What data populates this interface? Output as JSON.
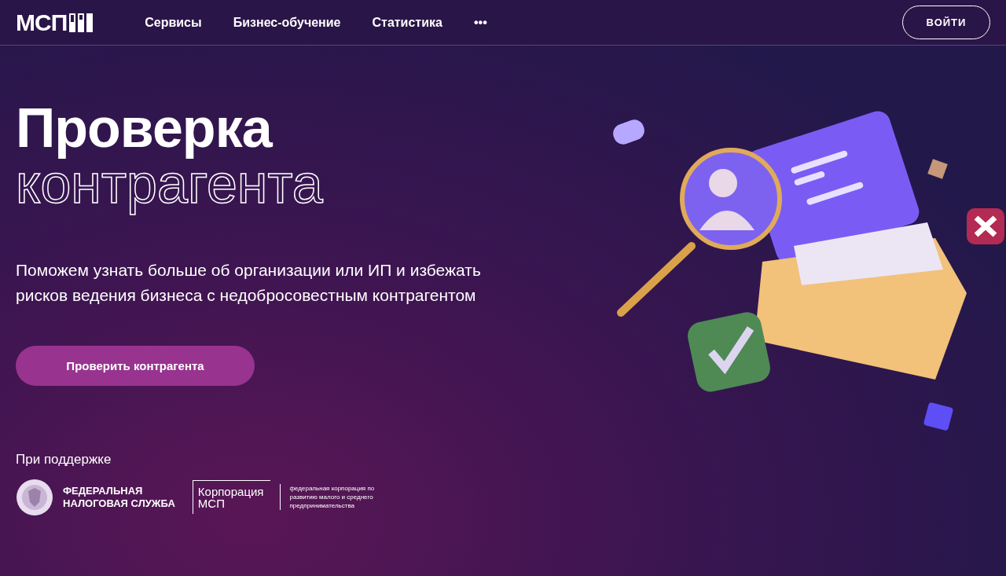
{
  "header": {
    "logo": "МСП",
    "nav": [
      {
        "label": "Сервисы"
      },
      {
        "label": "Бизнес-обучение"
      },
      {
        "label": "Статистика"
      },
      {
        "label": "•••"
      }
    ],
    "login": "ВОЙТИ"
  },
  "hero": {
    "title": "Проверка",
    "title_outline": "контрагента",
    "description": "Поможем узнать больше об организации или ИП и избежать рисков ведения бизнеса с недобросовестным контрагентом",
    "button": "Проверить контрагента"
  },
  "support": {
    "label": "При поддержке",
    "fns": [
      "ФЕДЕРАЛЬНАЯ",
      "НАЛОГОВАЯ СЛУЖБА"
    ],
    "corp": [
      "Корпорация",
      "МСП"
    ],
    "corp_note": "федеральная корпорация по развитию малого и среднего предпринимательства"
  }
}
